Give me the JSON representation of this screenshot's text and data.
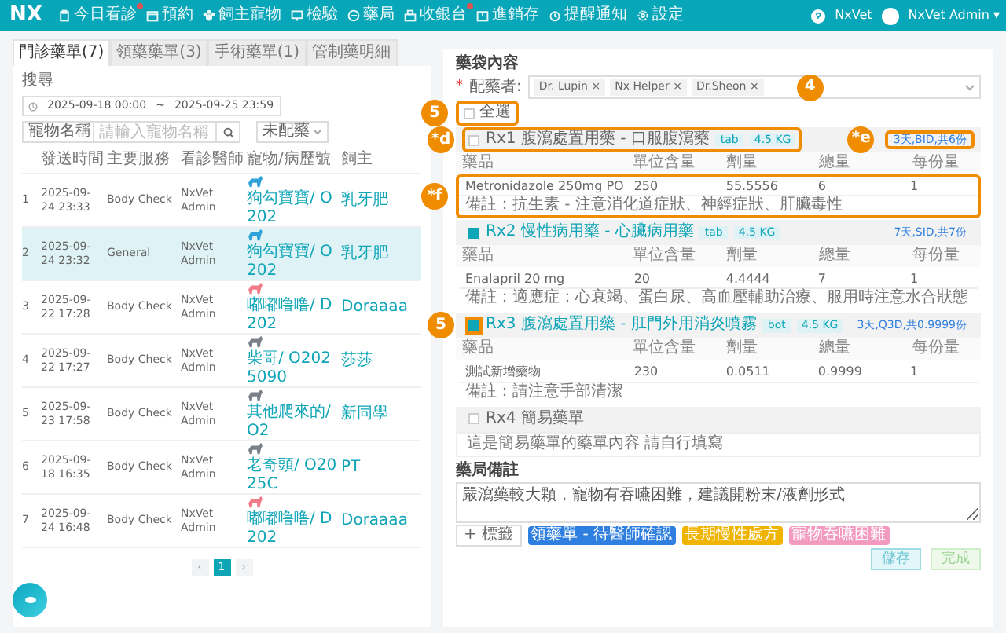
{
  "nav": {
    "logo": "NX",
    "items": [
      {
        "label": "今日看診",
        "badge": true
      },
      {
        "label": "預約",
        "badge": false
      },
      {
        "label": "飼主寵物",
        "badge": false
      },
      {
        "label": "檢驗",
        "badge": false
      },
      {
        "label": "藥局",
        "badge": false
      },
      {
        "label": "收銀台",
        "badge": true
      },
      {
        "label": "進銷存",
        "badge": false
      },
      {
        "label": "提醒通知",
        "badge": false
      },
      {
        "label": "設定",
        "badge": false
      }
    ],
    "clinic": "NxVet",
    "user": "NxVet Admin",
    "caret": "▾"
  },
  "tabs": [
    {
      "label": "門診藥單(7)",
      "selected": true
    },
    {
      "label": "領藥藥單(3)",
      "selected": false
    },
    {
      "label": "手術藥單(1)",
      "selected": false
    },
    {
      "label": "管制藥明細",
      "selected": false
    }
  ],
  "search": {
    "label": "搜尋",
    "date_from": "2025-09-18 00:00",
    "date_sep": "~",
    "date_to": "2025-09-25 23:59",
    "field_select": "寵物名稱",
    "placeholder": "請輸入寵物名稱",
    "status_select": "未配藥"
  },
  "table": {
    "columns": [
      "發送時間",
      "主要服務",
      "看診醫師",
      "寵物/病歷號",
      "飼主"
    ],
    "rows": [
      {
        "index": "1",
        "time": "2025-09-24 23:33",
        "service": "Body Check",
        "doctor": "NxVet Admin",
        "pet": "狗勾寶寶/ O202",
        "color": "#2fa3d9",
        "owner": "乳牙肥",
        "selected": false
      },
      {
        "index": "2",
        "time": "2025-09-24 23:32",
        "service": "General",
        "doctor": "NxVet Admin",
        "pet": "狗勾寶寶/ O202",
        "color": "#2fa3d9",
        "owner": "乳牙肥",
        "selected": true
      },
      {
        "index": "3",
        "time": "2025-09-22 17:28",
        "service": "Body Check",
        "doctor": "NxVet Admin",
        "pet": "嘟嘟噜噜/ D202",
        "color": "#f07c8a",
        "owner": "Doraaaa",
        "selected": false
      },
      {
        "index": "4",
        "time": "2025-09-22 17:27",
        "service": "Body Check",
        "doctor": "NxVet Admin",
        "pet": "柴哥/ O2025090",
        "color": "#7a8088",
        "owner": "莎莎",
        "selected": false
      },
      {
        "index": "5",
        "time": "2025-09-23 17:58",
        "service": "Body Check",
        "doctor": "NxVet Admin",
        "pet": "其他爬來的/ O2",
        "color": "#7a8088",
        "owner": "新同學",
        "selected": false
      },
      {
        "index": "6",
        "time": "2025-09-18 16:35",
        "service": "Body Check",
        "doctor": "NxVet Admin",
        "pet": "老奇頭/ O2025C",
        "color": "#7a8088",
        "owner": "PT",
        "selected": false
      },
      {
        "index": "7",
        "time": "2025-09-24 16:48",
        "service": "Body Check",
        "doctor": "NxVet Admin",
        "pet": "嘟嘟噜噜/ D202",
        "color": "#f07c8a",
        "owner": "Doraaaa",
        "selected": false
      }
    ]
  },
  "pagination": {
    "prev": "‹",
    "pages": [
      {
        "label": "1",
        "selected": true
      }
    ],
    "next": "›"
  },
  "panel": {
    "title": "藥袋內容",
    "assigners": {
      "required_mark": "*",
      "label": "配藥者:",
      "tags": [
        "Dr. Lupin",
        "Nx Helper",
        "Dr.Sheon"
      ],
      "remove": "×",
      "callout": "4"
    },
    "select_all": {
      "label": "全選",
      "checked": false,
      "outlined": true,
      "callout": "5"
    },
    "prescriptions": [
      {
        "kind": "table",
        "checked": false,
        "title": "Rx1 腹瀉處置用藥 - 口服腹瀉藥",
        "form": "tab",
        "weight": "4.5 KG",
        "schedule": "3天,BID,共6份",
        "columns": [
          "藥品",
          "單位含量",
          "劑量",
          "總量",
          "每份量"
        ],
        "items": [
          [
            "Metronidazole 250mg PO",
            "250",
            "55.5556",
            "6",
            "1"
          ]
        ],
        "note": "備註：抗生素 - 注意消化道症狀、神經症狀、肝臟毒性",
        "outlined": {
          "checkbox": false,
          "title": true,
          "schedule": true,
          "body": true
        },
        "callouts": {
          "title": "*d",
          "schedule": "*e",
          "body": "*f"
        }
      },
      {
        "kind": "table",
        "checked": true,
        "title": "Rx2 慢性病用藥 - 心臟病用藥",
        "form": "tab",
        "weight": "4.5 KG",
        "schedule": "7天,SID,共7份",
        "columns": [
          "藥品",
          "單位含量",
          "劑量",
          "總量",
          "每份量"
        ],
        "items": [
          [
            "Enalapril 20 mg",
            "20",
            "4.4444",
            "7",
            "1"
          ]
        ],
        "note": "備註：適應症：心衰竭、蛋白尿、高血壓輔助治療、服用時注意水合狀態",
        "outlined": {
          "checkbox": false,
          "title": false,
          "schedule": false,
          "body": false
        }
      },
      {
        "kind": "table",
        "checked": true,
        "title": "Rx3 腹瀉處置用藥 - 肛門外用消炎噴霧",
        "form": "bot",
        "weight": "4.5 KG",
        "schedule": "3天,Q3D,共0.9999份",
        "columns": [
          "藥品",
          "單位含量",
          "劑量",
          "總量",
          "每份量"
        ],
        "items": [
          [
            "測試新增藥物",
            "230",
            "0.0511",
            "0.9999",
            "1"
          ]
        ],
        "note": "備註：請注意手部清潔",
        "outlined": {
          "checkbox": true,
          "title": false,
          "schedule": false,
          "body": false
        },
        "callouts": {
          "checkbox": "5"
        }
      },
      {
        "kind": "simple",
        "checked": false,
        "title": "Rx4 簡易藥單",
        "content": "這是簡易藥單的藥單內容 請自行填寫",
        "outlined": {
          "checkbox": false,
          "title": false
        }
      }
    ],
    "remark": {
      "label": "藥局備註",
      "value": "嚴瀉藥較大顆，寵物有吞嚥困難，建議開粉末/液劑形式",
      "add_tag": "+ 標籤",
      "tags": [
        {
          "label": "領藥單 - 待醫師確認",
          "color": "#2f7fe0"
        },
        {
          "label": "長期慢性處方",
          "color": "#f0b400"
        },
        {
          "label": "寵物吞嚥困難",
          "color": "#f29ac0"
        }
      ]
    },
    "buttons": [
      {
        "label": "儲存",
        "kind": "save"
      },
      {
        "label": "完成",
        "kind": "done"
      }
    ]
  }
}
